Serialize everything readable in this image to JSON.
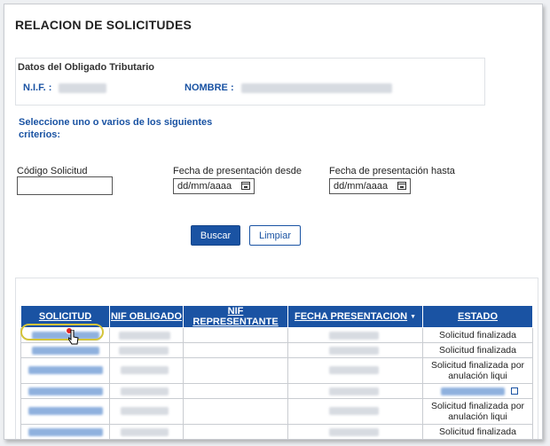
{
  "page": {
    "title": "RELACION DE SOLICITUDES"
  },
  "taxpayer": {
    "section_label": "Datos del Obligado Tributario",
    "nif_label": "N.I.F. :",
    "nombre_label": "NOMBRE :"
  },
  "criteria_prompt": "Seleccione uno o varios de los siguientes criterios:",
  "filters": {
    "code_label": "Código Solicitud",
    "code_value": "",
    "date_from_label": "Fecha de presentación desde",
    "date_from_value": "dd/mm/aaaa",
    "date_to_label": "Fecha de presentación hasta",
    "date_to_value": "dd/mm/aaaa"
  },
  "buttons": {
    "search": "Buscar",
    "clear": "Limpiar"
  },
  "table": {
    "headers": [
      "SOLICITUD",
      "NIF OBLIGADO",
      "NIF REPRESENTANTE",
      "FECHA PRESENTACION",
      "ESTADO"
    ],
    "sorted_column_index": 3,
    "rows": [
      {
        "estado": "Solicitud finalizada"
      },
      {
        "estado": "Solicitud finalizada"
      },
      {
        "estado": "Solicitud finalizada por anulación liqui"
      },
      {
        "estado": ""
      },
      {
        "estado": "Solicitud finalizada por anulación liqui"
      },
      {
        "estado": "Solicitud finalizada"
      }
    ]
  },
  "colors": {
    "accent": "#1a53a3",
    "highlight": "#d4c43a",
    "marker": "#e02424"
  },
  "icons": [
    "calendar-icon",
    "sort-desc-icon",
    "external-link-icon",
    "pointer-cursor-icon"
  ]
}
